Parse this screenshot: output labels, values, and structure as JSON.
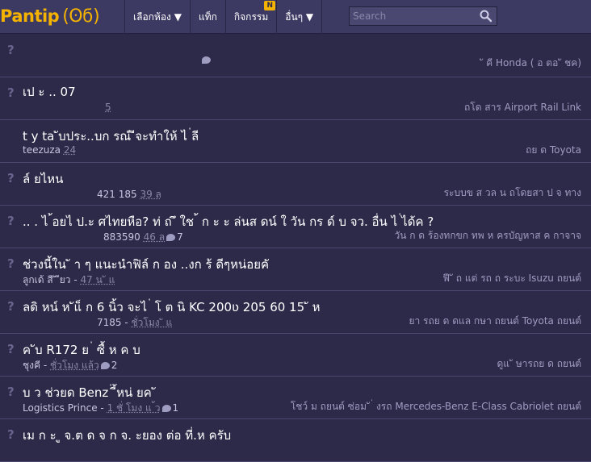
{
  "header": {
    "logo_text": "Pantip",
    "logo_mark": "(ʘϭ)",
    "nav": [
      {
        "label": "เลือกห้อง ▼"
      },
      {
        "label": "แท็ก"
      },
      {
        "label": "กิจกรรม",
        "badge": "N"
      },
      {
        "label": "อื่นๆ ▼"
      }
    ],
    "search_placeholder": "Search"
  },
  "topics": [
    {
      "mark": "?",
      "title": "",
      "meta_user": "",
      "meta_count": "",
      "meta_time": "",
      "comments": "",
      "tags": "ั คี     Honda ( อ ตอ ั ชค)"
    },
    {
      "mark": "?",
      "title": "                                                          เป ะ      .. 07",
      "meta_user": "",
      "meta_count": "",
      "meta_time": "5",
      "comments": "",
      "tags": "ถโด  สาร  Airport Rail Link"
    },
    {
      "mark": "",
      "title": "t y ta ับประ..บก รณ์ ีจะทำให้ ไ ่ลี",
      "meta_user": "teezuza",
      "meta_count": "",
      "meta_time": "24",
      "comments": "",
      "tags": "ถย  ด  Toyota"
    },
    {
      "mark": "?",
      "title": "     ล์   ยไหน",
      "meta_user": "",
      "meta_count": "421  185",
      "meta_time": "39                ล",
      "comments": "",
      "tags": "ระบบข  ส    วล  น   ถโดยสา ป  จ ทาง"
    },
    {
      "mark": "?",
      "title": "  .. . ไ  ้อยไ ป.ะ ศไทยหือ? ท่    ถ ึ ใช ้   ก  ะ  ะ ล่นส ดน์  ใ วัน    กร   ด์   บ   จว. อื่น   ไ  ่ได้ค    ?",
      "meta_user": "",
      "meta_count": "883590",
      "meta_time": "46              ล",
      "comments": "7",
      "tags": "วัน    ก      ด ร้องทกขก     ทพ  ห    ครบัญหาส  ค     กาจาจ"
    },
    {
      "mark": "?",
      "title": "ช่วงนี้ใน      ั       า  ๆ แนะนำฟิล์ ก อง ..งก ร้    ดีๆหน่อยคั",
      "meta_user": "ลูกเด้ สี ั ียว",
      "meta_count": "",
      "meta_time": "47 น    ั แ",
      "comments": "",
      "tags": "ฟี  ั  ถ        แต่ รถ    ถ ระบะ  Isuzu   ถยนต์"
    },
    {
      "mark": "?",
      "title": "      ลดิ   หน์  ห ัแ็ ก 6 นิ้ว จะไ ่ โ ต นิ KC 200ʋ 205 60 15     ั ห",
      "meta_user": "",
      "meta_count": "7185",
      "meta_time": "ชั่วโมง ั แ",
      "comments": "",
      "tags": "ยา รถย  ด  ดแล  กษา  ถยนต์  Toyota   ถยนต์"
    },
    {
      "mark": "?",
      "title": "           ค ับ R172 ย  ่  ซื้   ห  ค  บ",
      "meta_user": "ชุงคี",
      "meta_count": "",
      "meta_time": "ชั่วโมง  แล้ว",
      "comments": "2",
      "tags": "ดูแ   ั ษารถย  ด   ถยนต์"
    },
    {
      "mark": "?",
      "title": "  บ  ว  ช่วยด    Benz  ่    ี้หน่ ยค ั",
      "meta_user": "Logistics Prince",
      "meta_count": "",
      "meta_time": "1 ชั่ โมง  แ ้ว",
      "comments": "1",
      "tags": "โชว์  ม  ถยนต์  ซ่อม ั  ่ งรถ      Mercedes-Benz E-Class Cabriolet    ถยนต์"
    },
    {
      "mark": "?",
      "title": "  เม ก ะ  ู   จ.ต   ด จ ก จ. ะยอง ต่อ    ที่.ห  ครับ",
      "meta_user": "",
      "meta_count": "",
      "meta_time": "",
      "comments": "",
      "tags": ""
    }
  ],
  "colors": {
    "accent": "#f5b301",
    "background": "#2d2a49",
    "header": "#3c3963"
  }
}
